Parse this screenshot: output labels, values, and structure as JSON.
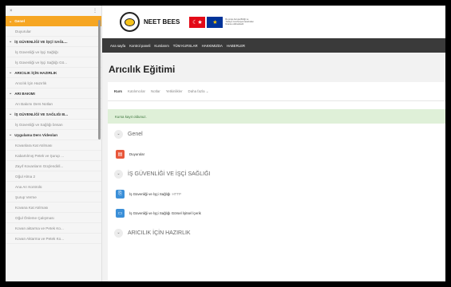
{
  "sidebar": {
    "close_glyph": "×",
    "menu_glyph": "⋮",
    "items": [
      {
        "label": "Genel",
        "type": "section-active"
      },
      {
        "label": "Duyurular",
        "type": "item"
      },
      {
        "label": "İŞ GÜVENLİĞİ VE İŞÇİ SAĞL...",
        "type": "section"
      },
      {
        "label": "İş Güvenliği ve İşçi Sağlığı",
        "type": "item"
      },
      {
        "label": "İş Güvenliği ve İşçi Sağlığı Gö...",
        "type": "item"
      },
      {
        "label": "ARICILIK İÇİN HAZIRLIK",
        "type": "section"
      },
      {
        "label": "Arıcılık İçin Hazırlık",
        "type": "item"
      },
      {
        "label": "ARI BAKIMI",
        "type": "section"
      },
      {
        "label": "Arı Bakımı Ders Notları",
        "type": "item"
      },
      {
        "label": "İŞ GÜVENLİĞİ VE SAĞLIĞI B...",
        "type": "section"
      },
      {
        "label": "İş Güvenliği ve Sağlığı bnsan",
        "type": "item"
      },
      {
        "label": "Uygulama Ders Videoları",
        "type": "section"
      },
      {
        "label": "Kovanlara Kat Atılması",
        "type": "item"
      },
      {
        "label": "Kabartılmış Petek ve Şurup ...",
        "type": "item"
      },
      {
        "label": "Zayıf Kovanların Güçlendiril...",
        "type": "item"
      },
      {
        "label": "Oğul Alma 2",
        "type": "item"
      },
      {
        "label": "Ana Arı Kontrolü",
        "type": "item"
      },
      {
        "label": "Şurup Verme",
        "type": "item"
      },
      {
        "label": "Kovana Kat Atılması",
        "type": "item"
      },
      {
        "label": "Oğul Önleme Çalışması",
        "type": "item"
      },
      {
        "label": "Kovan aktarma ve Petek Ko...",
        "type": "item"
      },
      {
        "label": "Kovan Aktarma ve Petek Ko...",
        "type": "item"
      }
    ]
  },
  "header": {
    "brand": "NEET BEES",
    "eu_caption": "Bu proje Avrupa Birliği ve Türkiye Cumhuriyeti tarafından finanse edilmektedir",
    "flag_tr": "☾★",
    "flag_eu": "★"
  },
  "navbar": {
    "items": [
      "Ana sayfa",
      "Kontrol paneli",
      "Kurslarım",
      "TÜM KURSLAR",
      "HAKKIMIZDA",
      "HABERLER"
    ]
  },
  "page": {
    "title": "Arıcılık Eğitimi"
  },
  "tabs": [
    "Kurs",
    "Katılımcılar",
    "Notlar",
    "Yetkinlikler",
    "Daha fazla ⌄"
  ],
  "alert": "Kursa kayıt oldunuz.",
  "sections": [
    {
      "title": "Genel",
      "activities": [
        {
          "label": "Duyurular",
          "tag": "",
          "color": "#e8573b",
          "icon": "forum-icon",
          "glyph": "▤"
        }
      ]
    },
    {
      "title": "İŞ GÜVENLİĞİ VE İŞÇİ SAĞLIĞI",
      "activities": [
        {
          "label": "İş Güvenliği ve İşçi Sağlığı",
          "tag": "HTTP",
          "color": "#3b8fd8",
          "icon": "file-icon",
          "glyph": "⎘"
        },
        {
          "label": "İş Güvenliği ve İşçi Sağlığı Görsel İşitsel İçerik",
          "tag": "",
          "color": "#3b8fd8",
          "icon": "folder-icon",
          "glyph": "▭"
        }
      ]
    },
    {
      "title": "ARICILIK İÇİN HAZIRLIK",
      "activities": []
    }
  ],
  "colors": {
    "accent": "#f6a623",
    "navbar": "#3a3a3a",
    "alert_bg": "#dff0d8"
  }
}
